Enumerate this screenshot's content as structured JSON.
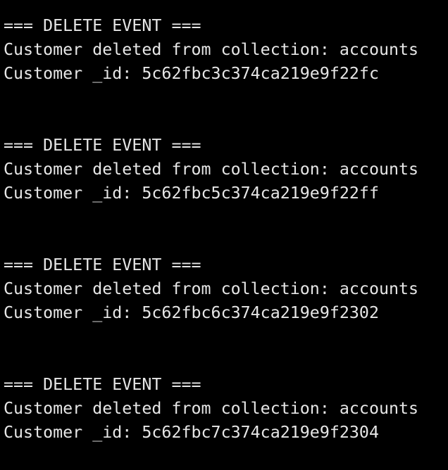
{
  "terminal": {
    "background": "#000000",
    "foreground": "#e6e6e6",
    "events": [
      {
        "header": "=== DELETE EVENT ===",
        "message": "Customer deleted from collection: accounts",
        "id_line": "Customer _id: 5c62fbc3c374ca219e9f22fc"
      },
      {
        "header": "=== DELETE EVENT ===",
        "message": "Customer deleted from collection: accounts",
        "id_line": "Customer _id: 5c62fbc5c374ca219e9f22ff"
      },
      {
        "header": "=== DELETE EVENT ===",
        "message": "Customer deleted from collection: accounts",
        "id_line": "Customer _id: 5c62fbc6c374ca219e9f2302"
      },
      {
        "header": "=== DELETE EVENT ===",
        "message": "Customer deleted from collection: accounts",
        "id_line": "Customer _id: 5c62fbc7c374ca219e9f2304"
      }
    ]
  }
}
